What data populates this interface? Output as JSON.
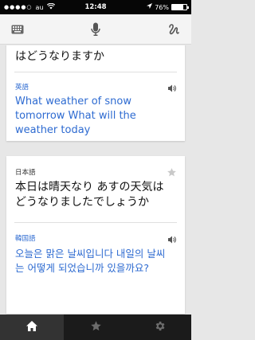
{
  "status": {
    "signal": "●●●●○",
    "carrier": "au",
    "time": "12:48",
    "battery_text": "76%",
    "battery_level": 0.76
  },
  "toolbar": {
    "keyboard_icon": "keyboard-icon",
    "mic_icon": "microphone-icon",
    "handwriting_icon": "handwriting-icon"
  },
  "cards": [
    {
      "source_text_tail": "はどうなりますか",
      "target_lang": "英語",
      "target_text": "What weather of snow tomorrow What will the weather today"
    },
    {
      "source_lang": "日本語",
      "source_text": "本日は晴天なり あすの天気はどうなりましたでしょうか",
      "target_lang": "韓国語",
      "target_text": "오늘은 맑은 날씨입니다 내일의 날씨는 어떻게 되었습니까 있을까요?"
    }
  ],
  "tabs": [
    "home-icon",
    "star-icon",
    "gear-icon"
  ],
  "colors": {
    "accent": "#2e6bd1",
    "tabbar": "#1b1b1b"
  }
}
